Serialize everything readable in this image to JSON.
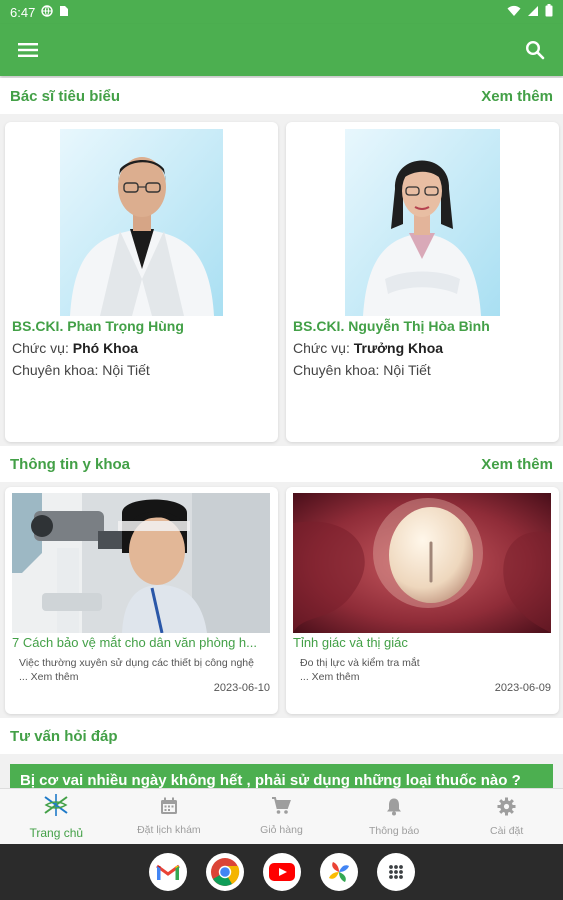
{
  "status_bar": {
    "time": "6:47"
  },
  "section_featured": {
    "title": "Bác sĩ tiêu biểu",
    "see_more": "Xem thêm"
  },
  "doctors": [
    {
      "name": "BS.CKI. Phan Trọng Hùng",
      "position_label": "Chức vụ:",
      "position": "Phó Khoa",
      "specialty_label": "Chuyên khoa:",
      "specialty": "Nội Tiết"
    },
    {
      "name": "BS.CKI. Nguyễn Thị Hòa Bình",
      "position_label": "Chức vụ:",
      "position": "Trưởng Khoa",
      "specialty_label": "Chuyên khoa:",
      "specialty": "Nội Tiết"
    }
  ],
  "section_medical": {
    "title": "Thông tin y khoa",
    "see_more": "Xem thêm"
  },
  "articles": [
    {
      "title": "7 Cách bảo vệ mắt cho dân văn phòng h...",
      "desc_line1": "Việc thường xuyên sử dụng các thiết bị công nghệ",
      "desc_line2": "... Xem thêm",
      "date": "2023-06-10"
    },
    {
      "title": "Tỉnh giác và thị giác",
      "desc_line1": "Đo thị lực và kiểm tra mắt",
      "desc_line2": "... Xem thêm",
      "date": "2023-06-09"
    }
  ],
  "section_qa": {
    "title": "Tư vấn hỏi đáp"
  },
  "qa_banner": "Bị cơ vai nhiều ngày không hết , phải sử dụng những loại thuốc nào ?",
  "bottom_nav": [
    {
      "label": "Trang chủ",
      "icon": "home-logo-icon",
      "active": true
    },
    {
      "label": "Đặt lịch khám",
      "icon": "calendar-icon",
      "active": false
    },
    {
      "label": "Giỏ hàng",
      "icon": "cart-icon",
      "active": false
    },
    {
      "label": "Thông báo",
      "icon": "bell-icon",
      "active": false
    },
    {
      "label": "Cài đặt",
      "icon": "gear-icon",
      "active": false
    }
  ],
  "dock": [
    "gmail-icon",
    "chrome-icon",
    "youtube-icon",
    "photos-icon",
    "app-drawer-icon"
  ],
  "colors": {
    "primary": "#4caf50",
    "primary_text": "#43a047",
    "background": "#f1f1f1"
  }
}
